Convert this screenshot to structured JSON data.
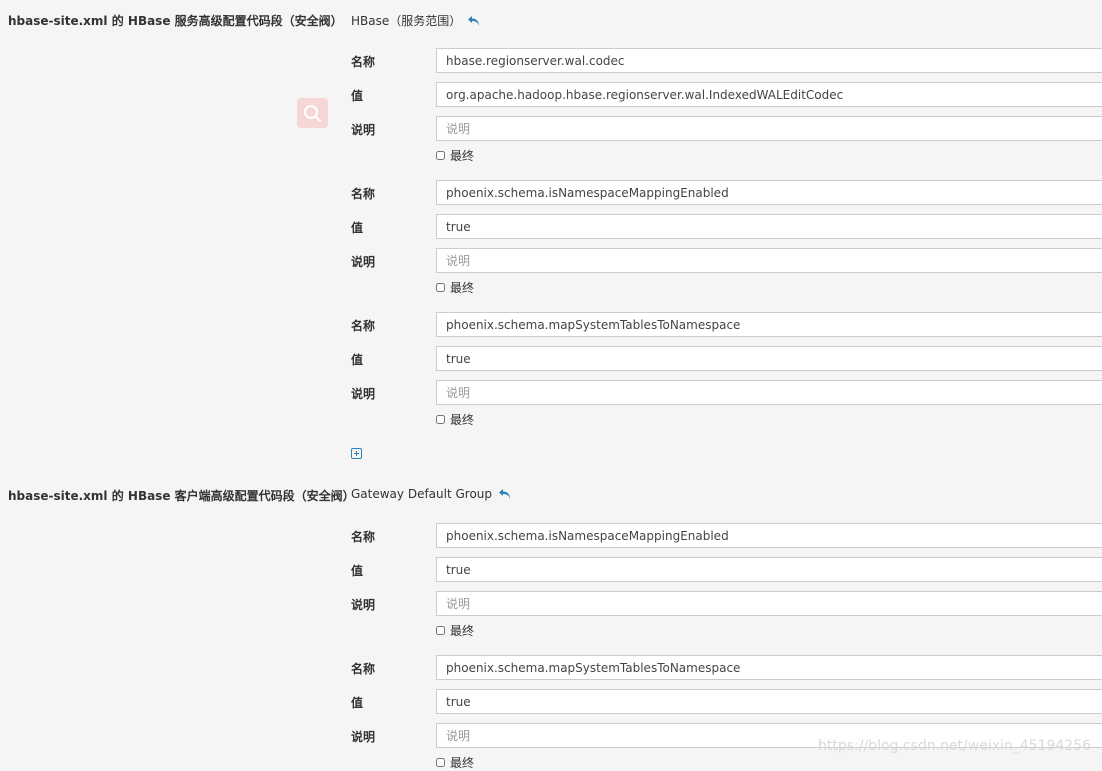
{
  "sections": [
    {
      "title": "hbase-site.xml 的 HBase 服务高级配置代码段（安全阀）",
      "scope": "HBase（服务范围）",
      "entries": [
        {
          "name": "hbase.regionserver.wal.codec",
          "value": "org.apache.hadoop.hbase.regionserver.wal.IndexedWALEditCodec",
          "description": ""
        },
        {
          "name": "phoenix.schema.isNamespaceMappingEnabled",
          "value": "true",
          "description": ""
        },
        {
          "name": "phoenix.schema.mapSystemTablesToNamespace",
          "value": "true",
          "description": ""
        }
      ]
    },
    {
      "title": "hbase-site.xml 的 HBase 客户端高级配置代码段（安全阀）",
      "scope": "Gateway Default Group",
      "entries": [
        {
          "name": "phoenix.schema.isNamespaceMappingEnabled",
          "value": "true",
          "description": ""
        },
        {
          "name": "phoenix.schema.mapSystemTablesToNamespace",
          "value": "true",
          "description": ""
        }
      ]
    }
  ],
  "labels": {
    "name": "名称",
    "value": "值",
    "description": "说明",
    "description_placeholder": "说明",
    "final": "最终"
  },
  "icons": {
    "undo": "undo-arrow-icon",
    "add": "plus-square-icon",
    "search": "search-icon"
  },
  "colors": {
    "accent": "#2f7fb8",
    "badge": "#f6d7d6"
  },
  "watermark": "https://blog.csdn.net/weixin_45194256"
}
